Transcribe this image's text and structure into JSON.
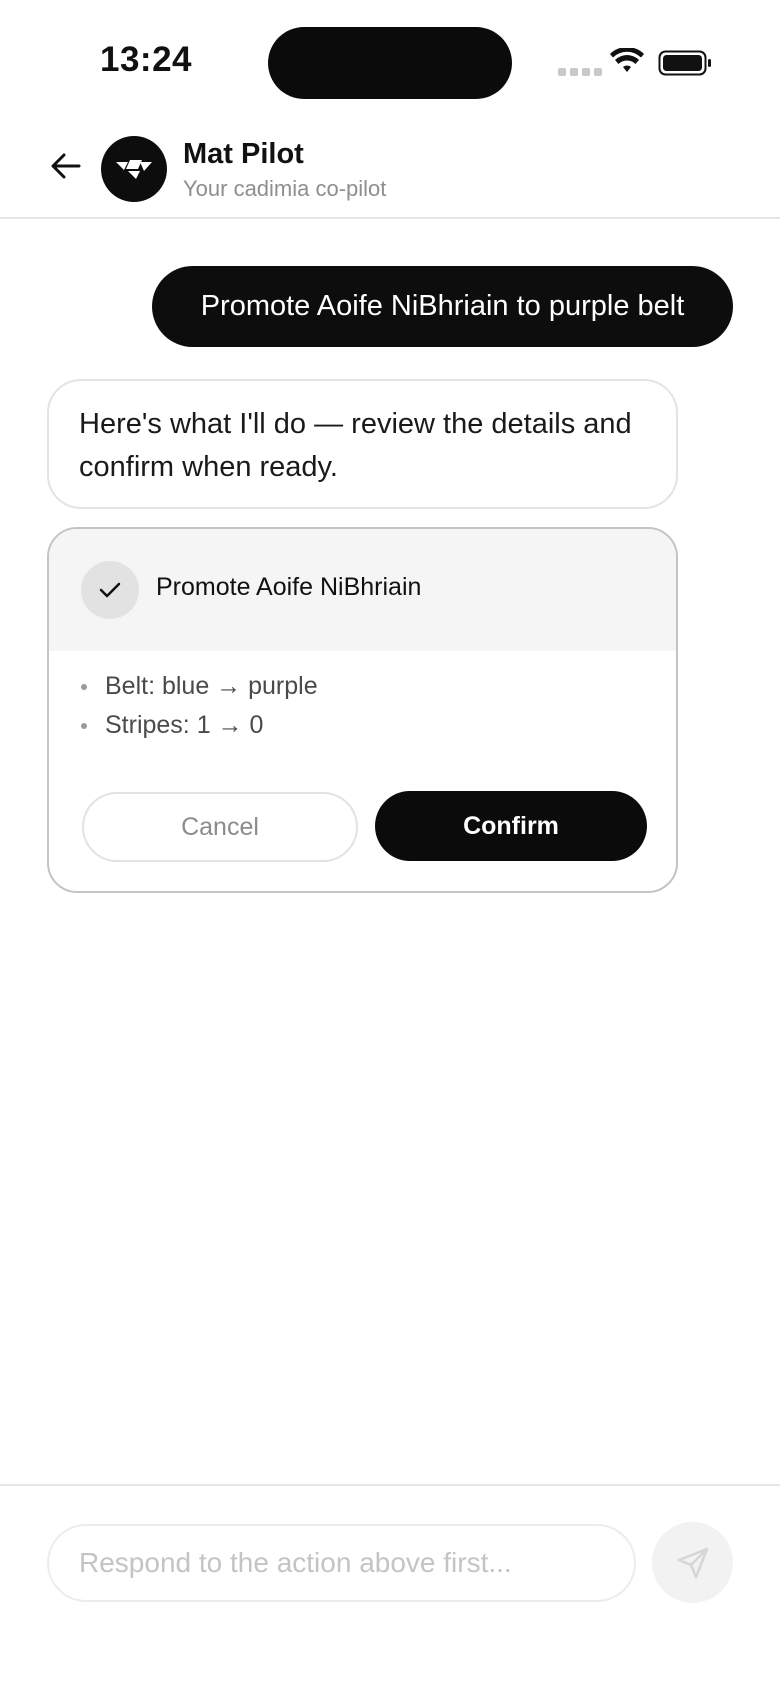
{
  "status_bar": {
    "time": "13:24"
  },
  "header": {
    "title": "Mat Pilot",
    "subtitle": "Your cadimia co-pilot"
  },
  "messages": {
    "user": "Promote Aoife NiBhriain to purple belt",
    "assistant": "Here's what I'll do — review the details and confirm when ready."
  },
  "action_card": {
    "title": "Promote Aoife NiBhriain",
    "details": [
      "Belt: blue → purple",
      "Stripes: 1 → 0"
    ],
    "cancel_label": "Cancel",
    "confirm_label": "Confirm"
  },
  "composer": {
    "placeholder": "Respond to the action above first..."
  },
  "icons": {
    "back": "arrow-left-icon",
    "avatar": "mat-pilot-logo",
    "check": "check-icon",
    "send": "send-icon",
    "wifi": "wifi-icon",
    "battery": "battery-icon"
  },
  "colors": {
    "primary": "#0b0b0b",
    "card_head_bg": "#f5f5f5",
    "muted_text": "#8e8e8e"
  }
}
